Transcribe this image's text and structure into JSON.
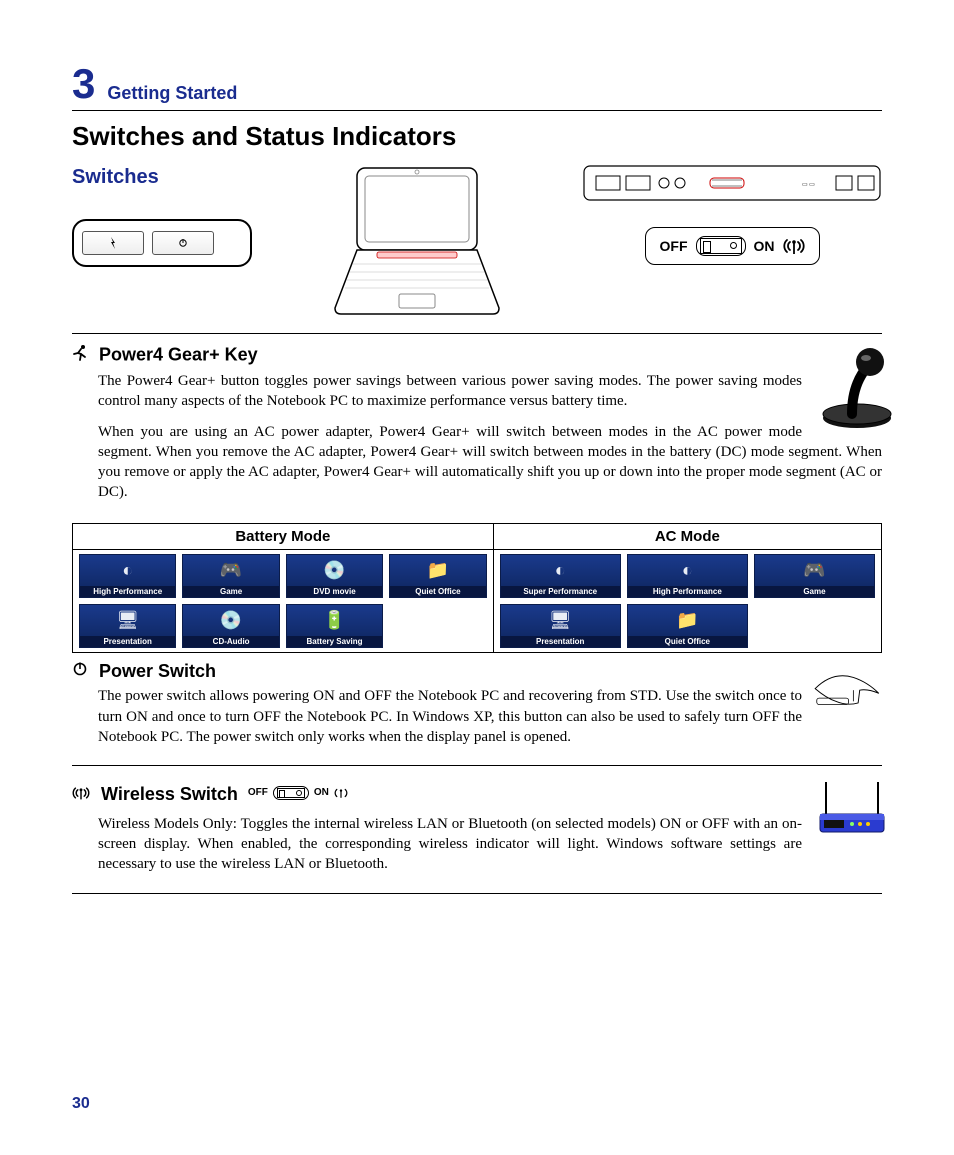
{
  "chapter": {
    "number": "3",
    "title": "Getting Started"
  },
  "page_title": "Switches and Status Indicators",
  "sections": {
    "switches_heading": "Switches",
    "power4": {
      "heading": "Power4 Gear+ Key",
      "p1": "The Power4 Gear+ button toggles power savings between various power saving modes. The power saving modes control many aspects of the Notebook PC to maximize performance versus battery time.",
      "p2": "When you are using an AC power adapter, Power4 Gear+ will switch between modes in the AC power mode segment. When you remove the AC adapter, Power4 Gear+ will switch between modes in the battery (DC) mode segment. When you remove or apply the AC adapter, Power4 Gear+ will automatically shift you up or down into the proper mode segment (AC or DC)."
    },
    "power_switch": {
      "heading": "Power Switch",
      "p1": "The power switch allows powering ON and OFF the Notebook PC and recovering from STD. Use the switch once to turn ON and once to turn OFF the Notebook PC. In Windows XP, this button can also be used to safely turn OFF the Notebook PC. The power switch only works when the display panel is opened."
    },
    "wireless_switch": {
      "heading": "Wireless Switch",
      "p1": "Wireless Models Only: Toggles the internal wireless LAN or Bluetooth (on selected models) ON or OFF with an on-screen display. When enabled, the corresponding wireless indicator will light. Windows software settings are necessary to use the wireless LAN or Bluetooth."
    }
  },
  "switch_badge": {
    "off": "OFF",
    "on": "ON"
  },
  "mode_table": {
    "headers": {
      "battery": "Battery Mode",
      "ac": "AC Mode"
    },
    "battery_tiles": [
      {
        "label": "High Performance",
        "glyph": "◐"
      },
      {
        "label": "Game",
        "glyph": "🎮"
      },
      {
        "label": "DVD movie",
        "glyph": "💿"
      },
      {
        "label": "Quiet Office",
        "glyph": "📁"
      },
      {
        "label": "Presentation",
        "glyph": "🖥"
      },
      {
        "label": "CD-Audio",
        "glyph": "💿"
      },
      {
        "label": "Battery Saving",
        "glyph": "🔋"
      }
    ],
    "ac_tiles": [
      {
        "label": "Super Performance",
        "glyph": "◐"
      },
      {
        "label": "High Performance",
        "glyph": "◐"
      },
      {
        "label": "Game",
        "glyph": "🎮"
      },
      {
        "label": "Presentation",
        "glyph": "🖥"
      },
      {
        "label": "Quiet Office",
        "glyph": "📁"
      }
    ]
  },
  "page_number": "30"
}
